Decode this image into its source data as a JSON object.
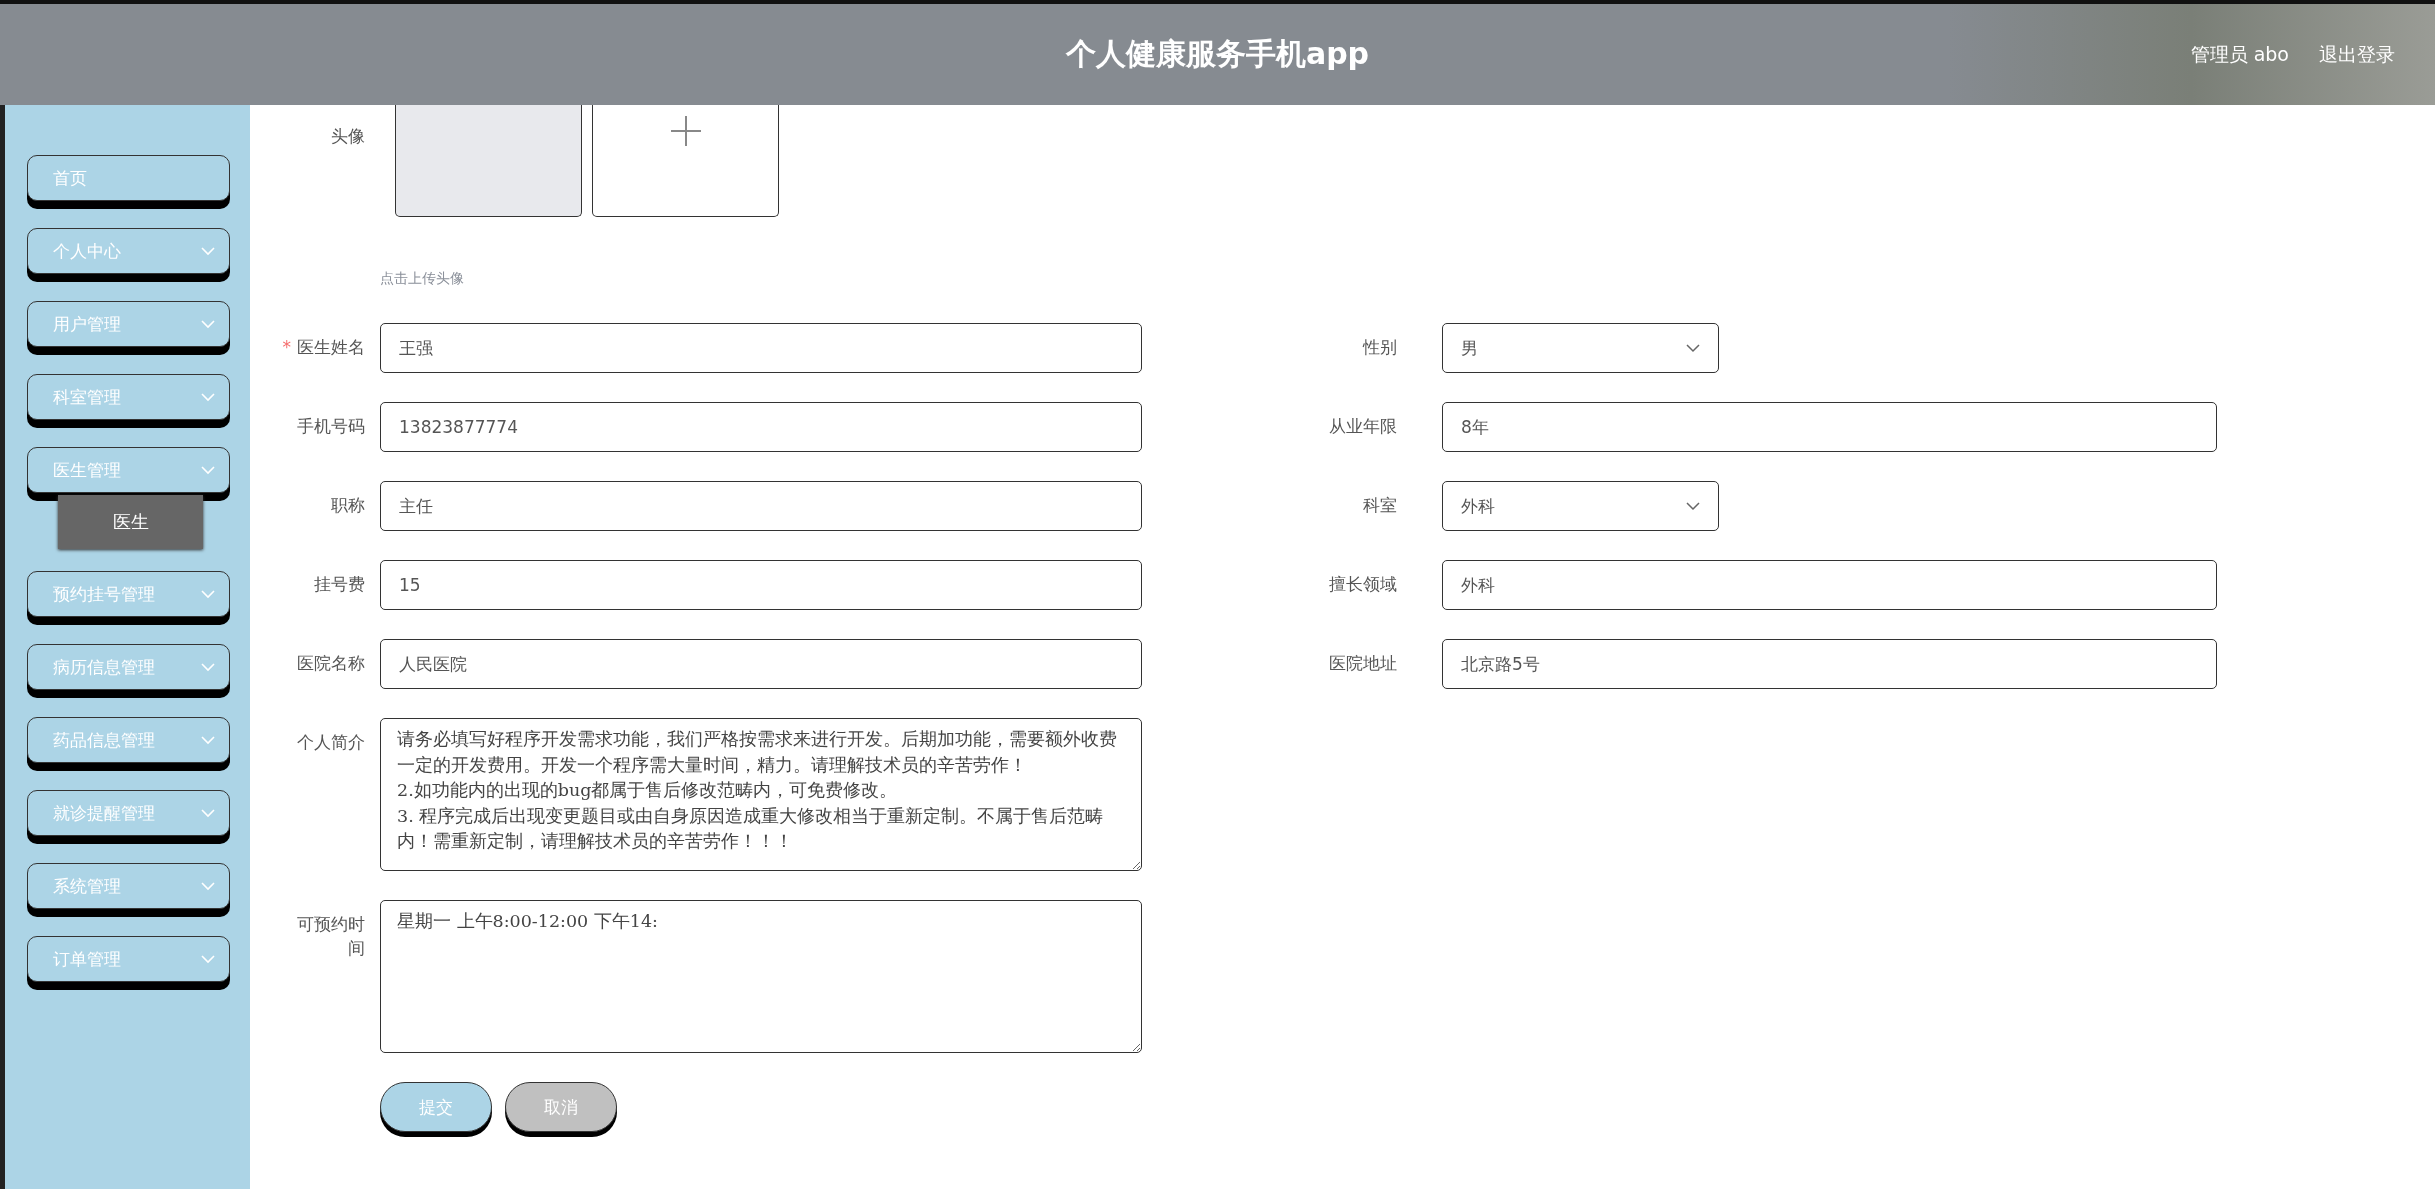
{
  "header": {
    "title": "个人健康服务手机app",
    "user": "管理员 abo",
    "logout": "退出登录"
  },
  "sidebar": {
    "items": [
      {
        "label": "首页",
        "kind": "link",
        "selected": false
      },
      {
        "label": "个人中心",
        "kind": "menu",
        "selected": false
      },
      {
        "label": "用户管理",
        "kind": "menu",
        "selected": false
      },
      {
        "label": "科室管理",
        "kind": "menu",
        "selected": false
      },
      {
        "label": "医生管理",
        "kind": "menu",
        "selected": false,
        "expanded": true,
        "children": [
          {
            "label": "医生",
            "selected": true
          }
        ]
      },
      {
        "label": "预约挂号管理",
        "kind": "menu",
        "selected": false
      },
      {
        "label": "病历信息管理",
        "kind": "menu",
        "selected": false
      },
      {
        "label": "药品信息管理",
        "kind": "menu",
        "selected": false
      },
      {
        "label": "就诊提醒管理",
        "kind": "menu",
        "selected": false
      },
      {
        "label": "系统管理",
        "kind": "menu",
        "selected": false
      },
      {
        "label": "订单管理",
        "kind": "menu",
        "selected": false
      }
    ]
  },
  "form": {
    "required_mark": "*",
    "avatar": {
      "label": "头像",
      "hint": "点击上传头像"
    },
    "rows": [
      [
        {
          "label": "医生姓名",
          "kind": "input",
          "required": true,
          "value": "王强"
        },
        {
          "label": "性别",
          "kind": "select",
          "required": false,
          "value": "男"
        }
      ],
      [
        {
          "label": "手机号码",
          "kind": "input",
          "required": false,
          "value": "13823877774"
        },
        {
          "label": "从业年限",
          "kind": "input",
          "required": false,
          "value": "8年"
        }
      ],
      [
        {
          "label": "职称",
          "kind": "input",
          "required": false,
          "value": "主任"
        },
        {
          "label": "科室",
          "kind": "select",
          "required": false,
          "value": "外科"
        }
      ],
      [
        {
          "label": "挂号费",
          "kind": "input",
          "required": false,
          "value": "15"
        },
        {
          "label": "擅长领域",
          "kind": "input",
          "required": false,
          "value": "外科"
        }
      ],
      [
        {
          "label": "医院名称",
          "kind": "input",
          "required": false,
          "value": "人民医院"
        },
        {
          "label": "医院地址",
          "kind": "input",
          "required": false,
          "value": "北京路5号"
        }
      ],
      [
        {
          "label": "个人简介",
          "kind": "textarea",
          "required": false,
          "value": "请务必填写好程序开发需求功能，我们严格按需求来进行开发。后期加功能，需要额外收费一定的开发费用。开发一个程序需大量时间，精力。请理解技术员的辛苦劳作！\n2.如功能内的出现的bug都属于售后修改范畴内，可免费修改。\n3. 程序完成后出现变更题目或由自身原因造成重大修改相当于重新定制。不属于售后范畴内！需重新定制，请理解技术员的辛苦劳作！！！"
        }
      ],
      [
        {
          "label": "可预约时间",
          "kind": "textarea",
          "required": false,
          "value": "星期一 上午8:00-12:00 下午14:"
        }
      ]
    ],
    "buttons": [
      {
        "label": "提交",
        "kind": "primary"
      },
      {
        "label": "取消",
        "kind": "cancel"
      }
    ]
  }
}
